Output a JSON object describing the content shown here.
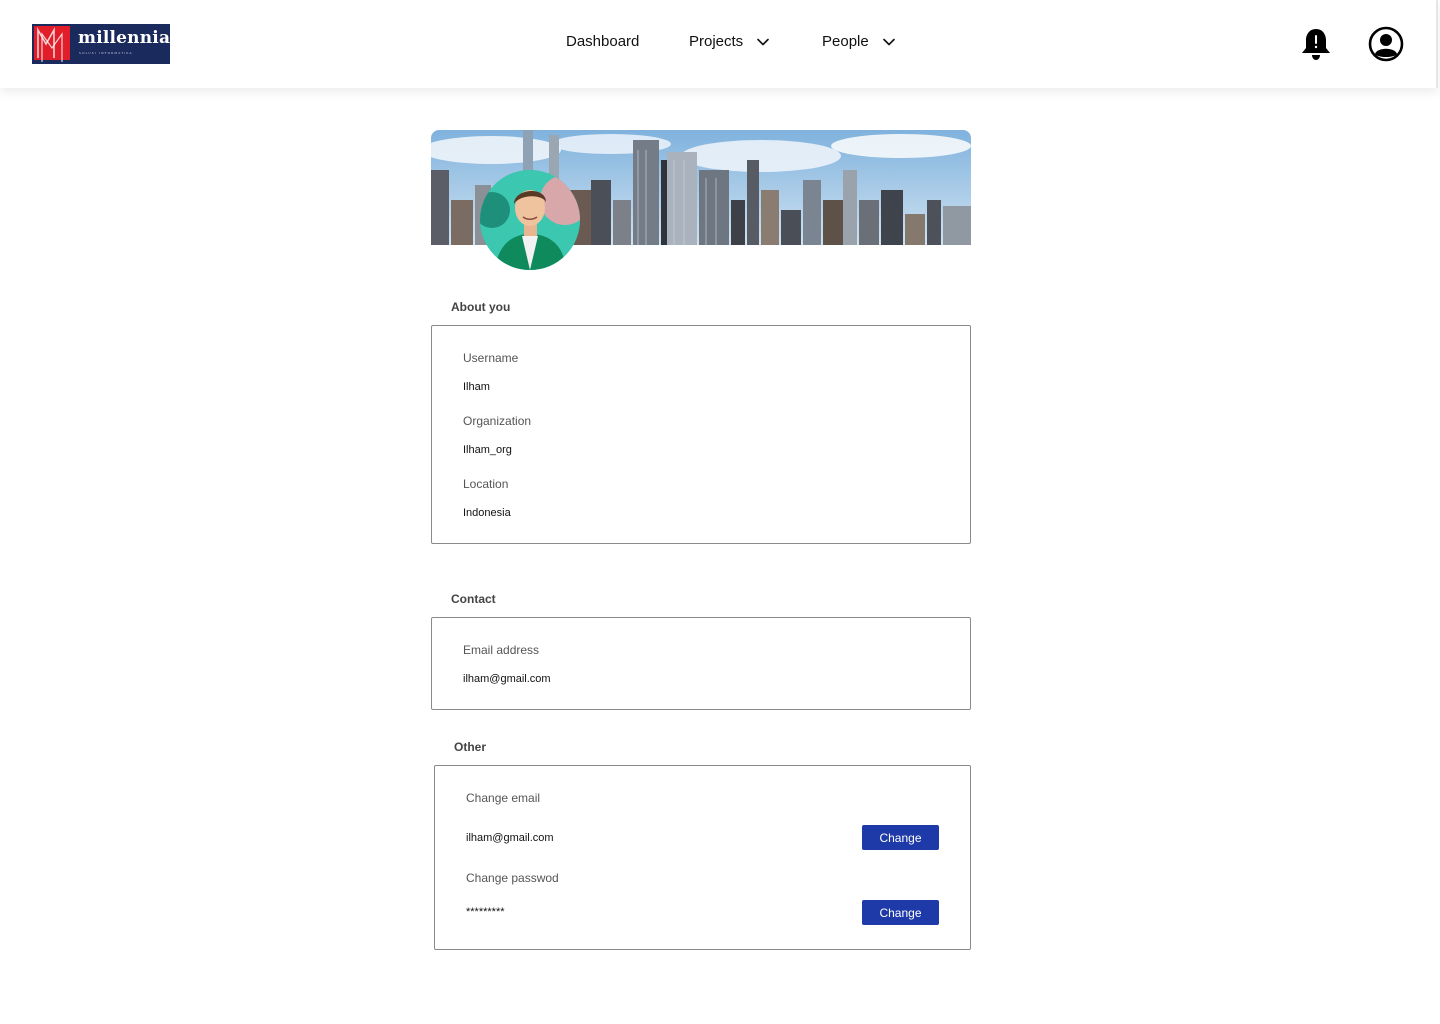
{
  "brand": {
    "name": "millennia",
    "tagline": "SOLUSI INFORMATIKA",
    "colors": {
      "navy": "#1b2a5c",
      "red": "#e11d2a"
    }
  },
  "nav": {
    "dashboard": "Dashboard",
    "projects": "Projects",
    "people": "People",
    "icons": [
      "chevron-down-icon",
      "bell-icon",
      "user-circle-icon"
    ]
  },
  "about": {
    "title": "About you",
    "username_label": "Username",
    "username": "Ilham",
    "organization_label": "Organization",
    "organization": "Ilham_org",
    "location_label": "Location",
    "location": "Indonesia"
  },
  "contact": {
    "title": "Contact",
    "email_label": "Email address",
    "email": "ilham@gmail.com"
  },
  "other": {
    "title": "Other",
    "change_email_label": "Change email",
    "current_email": "ilham@gmail.com",
    "change_password_label": "Change passwod",
    "password_masked": "*********",
    "change_button": "Change",
    "button_color": "#1e3aa8"
  }
}
